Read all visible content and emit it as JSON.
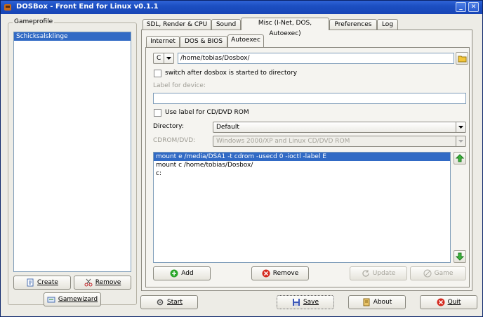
{
  "window": {
    "title": "DOSBox - Front End for Linux v0.1.1",
    "minimize_glyph": "_",
    "close_glyph": "✕"
  },
  "gameprofile": {
    "group_title": "Gameprofile",
    "items": [
      "Schicksalsklinge"
    ],
    "create_label": "Create",
    "remove_label": "Remove",
    "gamewizard_label": "Gamewizard"
  },
  "tabs": [
    "SDL, Render & CPU",
    "Sound",
    "Misc (I-Net, DOS, Autoexec)",
    "Preferences",
    "Log"
  ],
  "subtabs": [
    "Internet",
    "DOS & BIOS",
    "Autoexec"
  ],
  "autoexec": {
    "drive_value": "C",
    "path_value": "/home/tobias/Dosbox/",
    "switch_label": "switch after dosbox is started to directory",
    "label_for_device": "Label for device:",
    "label_input_value": "",
    "use_label_cdrom": "Use label for CD/DVD ROM",
    "directory_label": "Directory:",
    "directory_value": "Default",
    "cdrom_label": "CDROM/DVD:",
    "cdrom_value": "Windows 2000/XP and Linux CD/DVD ROM",
    "commands": [
      "mount e /media/DSA1 -t cdrom -usecd 0 -ioctl -label E",
      "mount c /home/tobias/Dosbox/",
      "c:"
    ],
    "add_label": "Add",
    "remove_label": "Remove",
    "update_label": "Update",
    "game_label": "Game"
  },
  "bottom": {
    "start_label": "Start",
    "save_label": "Save",
    "about_label": "About",
    "quit_label": "Quit"
  },
  "colors": {
    "selection": "#316ac5",
    "titlebar": "#1c4fc2",
    "add_green": "#2aa62a",
    "remove_red": "#d42a1f",
    "arrow_green": "#3cb33c"
  }
}
